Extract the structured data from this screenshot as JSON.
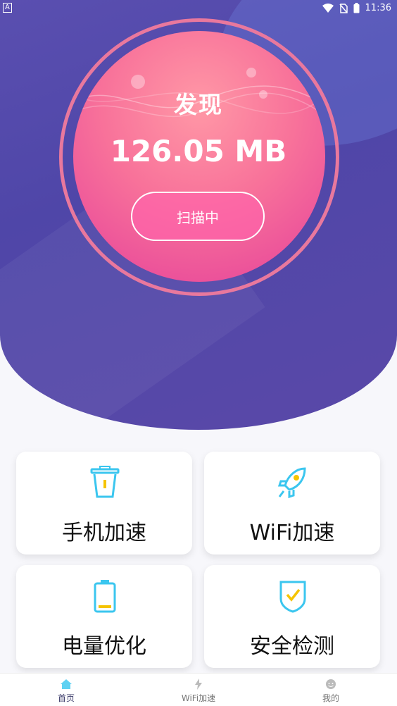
{
  "status_bar": {
    "time": "11:36",
    "left_indicator": "A"
  },
  "hero": {
    "found_label": "发现",
    "size_value": "126.05 MB",
    "scan_button_label": "扫描中"
  },
  "cards": [
    {
      "label": "手机加速",
      "icon": "trash-icon"
    },
    {
      "label": "WiFi加速",
      "icon": "rocket-icon"
    },
    {
      "label": "电量优化",
      "icon": "battery-icon"
    },
    {
      "label": "安全检测",
      "icon": "shield-check-icon"
    }
  ],
  "tabs": [
    {
      "label": "首页",
      "icon": "home-icon",
      "active": true
    },
    {
      "label": "WiFi加速",
      "icon": "lightning-icon",
      "active": false
    },
    {
      "label": "我的",
      "icon": "face-icon",
      "active": false
    }
  ],
  "colors": {
    "accent_blue": "#3bc6ef",
    "accent_yellow": "#f5c400",
    "hero_bg": "#4f46a8",
    "orb_pink": "#f8729a"
  }
}
